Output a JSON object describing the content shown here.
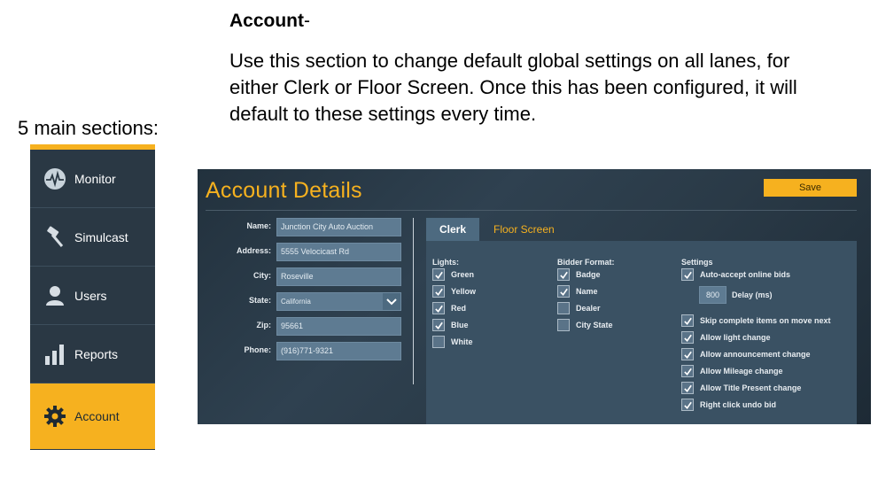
{
  "annotation": {
    "heading_bold": "Account",
    "heading_suffix": "-",
    "description": "Use this section to change default global settings on all lanes, for either Clerk or Floor Screen. Once this has been configured, it will default to these settings every time.",
    "sections_label": "5 main sections:"
  },
  "sidebar": {
    "items": [
      {
        "label": "Monitor",
        "icon": "monitor-pulse-icon"
      },
      {
        "label": "Simulcast",
        "icon": "gavel-icon"
      },
      {
        "label": "Users",
        "icon": "user-icon"
      },
      {
        "label": "Reports",
        "icon": "bar-chart-icon"
      },
      {
        "label": "Account",
        "icon": "gear-icon",
        "active": true
      }
    ]
  },
  "panel": {
    "title": "Account Details",
    "save_label": "Save",
    "fields": {
      "name": {
        "label": "Name:",
        "value": "Junction City Auto Auction"
      },
      "address": {
        "label": "Address:",
        "value": "5555 Velocicast Rd"
      },
      "city": {
        "label": "City:",
        "value": "Roseville"
      },
      "state": {
        "label": "State:",
        "value": "California"
      },
      "zip": {
        "label": "Zip:",
        "value": "95661"
      },
      "phone": {
        "label": "Phone:",
        "value": "(916)771-9321"
      }
    },
    "tabs": {
      "clerk": "Clerk",
      "floor": "Floor Screen"
    },
    "lights": {
      "header": "Lights:",
      "items": [
        {
          "label": "Green",
          "checked": true
        },
        {
          "label": "Yellow",
          "checked": true
        },
        {
          "label": "Red",
          "checked": true
        },
        {
          "label": "Blue",
          "checked": true
        },
        {
          "label": "White",
          "checked": false
        }
      ]
    },
    "bidder_format": {
      "header": "Bidder Format:",
      "items": [
        {
          "label": "Badge",
          "checked": true
        },
        {
          "label": "Name",
          "checked": true
        },
        {
          "label": "Dealer",
          "checked": false
        },
        {
          "label": "City State",
          "checked": false
        }
      ]
    },
    "settings": {
      "header": "Settings",
      "auto_accept": "Auto-accept online bids",
      "delay_value": "800",
      "delay_label": "Delay (ms)",
      "items": [
        {
          "label": "Skip complete items on move next",
          "checked": true
        },
        {
          "label": "Allow light change",
          "checked": true
        },
        {
          "label": "Allow announcement change",
          "checked": true
        },
        {
          "label": "Allow Mileage change",
          "checked": true
        },
        {
          "label": "Allow Title Present change",
          "checked": true
        },
        {
          "label": "Right click undo bid",
          "checked": true
        }
      ]
    }
  },
  "colors": {
    "accent": "#f6b11f",
    "sidebar_bg": "#2a3844",
    "panel_bg": "#2f4150",
    "input_bg": "#5e7b92"
  }
}
